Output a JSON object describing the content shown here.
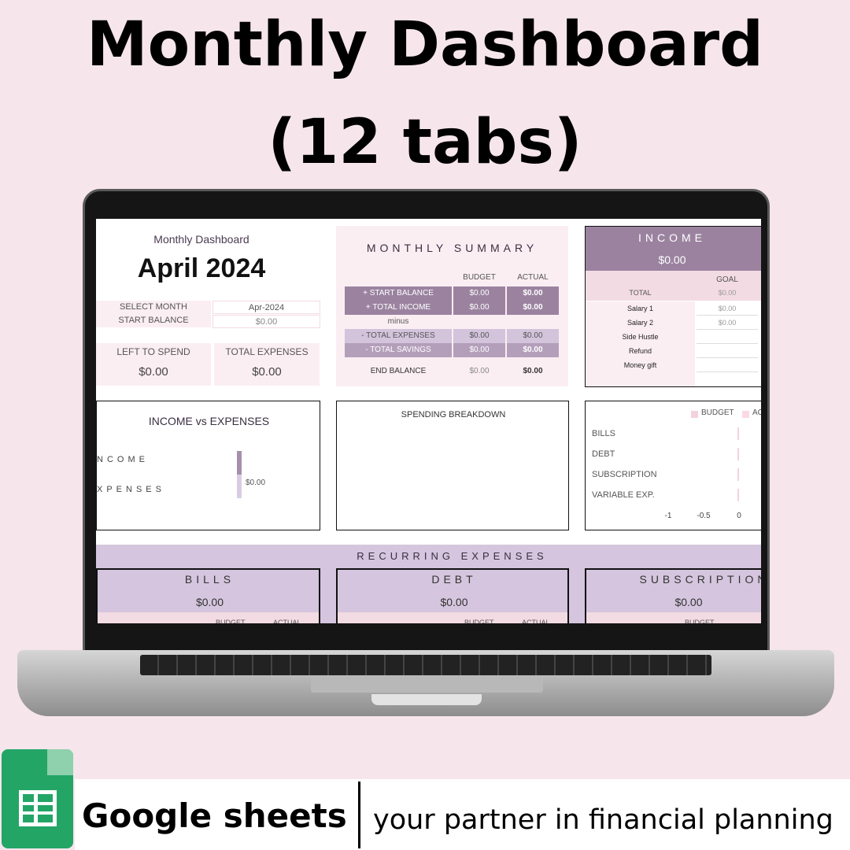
{
  "headline": {
    "line1": "Monthly Dashboard",
    "line2": "(12 tabs)"
  },
  "sheet": {
    "subtitle": "Monthly Dashboard",
    "title": "April 2024",
    "select_month_label": "SELECT MONTH",
    "select_month_value": "Apr-2024",
    "start_balance_label": "START BALANCE",
    "start_balance_value": "$0.00",
    "left_to_spend_label": "LEFT TO SPEND",
    "left_to_spend_value": "$0.00",
    "total_expenses_label": "TOTAL EXPENSES",
    "total_expenses_value": "$0.00",
    "summary": {
      "title": "MONTHLY  SUMMARY",
      "col_budget": "BUDGET",
      "col_actual": "ACTUAL",
      "rows": [
        {
          "label": "+ START BALANCE",
          "budget": "$0.00",
          "actual": "$0.00"
        },
        {
          "label": "+ TOTAL INCOME",
          "budget": "$0.00",
          "actual": "$0.00"
        },
        {
          "label": "- TOTAL EXPENSES",
          "budget": "$0.00",
          "actual": "$0.00"
        },
        {
          "label": "- TOTAL SAVINGS",
          "budget": "$0.00",
          "actual": "$0.00"
        }
      ],
      "minus": "minus",
      "end": {
        "label": "END BALANCE",
        "budget": "$0.00",
        "actual": "$0.00"
      }
    },
    "income": {
      "title": "INCOME",
      "value": "$0.00",
      "goal": "GOAL",
      "total_label": "TOTAL",
      "total_value": "$0.00",
      "rows": [
        {
          "label": "Salary 1",
          "value": "$0.00"
        },
        {
          "label": "Salary 2",
          "value": "$0.00"
        },
        {
          "label": "Side Hustle",
          "value": ""
        },
        {
          "label": "Refund",
          "value": ""
        },
        {
          "label": "Money gift",
          "value": ""
        }
      ]
    },
    "income_vs_expenses": {
      "title": "INCOME vs EXPENSES",
      "income_label": "NCOME",
      "expenses_label": "XPENSES",
      "value_label": "$0.00"
    },
    "spending_breakdown": {
      "title": "SPENDING BREAKDOWN"
    },
    "recurring": {
      "title": "RECURRING EXPENSES",
      "col_budget": "BUDGET",
      "col_actual": "ACTUAL",
      "cards": [
        {
          "title": "BILLS",
          "value": "$0.00"
        },
        {
          "title": "DEBT",
          "value": "$0.00"
        },
        {
          "title": "SUBSCRIPTION",
          "value": "$0.00"
        }
      ]
    }
  },
  "chart_data": {
    "type": "bar",
    "orientation": "horizontal",
    "categories": [
      "BILLS",
      "DEBT",
      "SUBSCRIPTION",
      "VARIABLE EXP."
    ],
    "series": [
      {
        "name": "BUDGET",
        "values": [
          0,
          0,
          0,
          0
        ]
      },
      {
        "name": "AC",
        "values": [
          0,
          0,
          0,
          0
        ]
      }
    ],
    "ticks": [
      "-1",
      "-0.5",
      "0"
    ],
    "xlim": [
      -1,
      0
    ],
    "legend": "top-right",
    "colors": {
      "budget": "#f2d3dd",
      "actual": "#fbd9e3"
    }
  },
  "footer": {
    "brand": "Google sheets",
    "tagline": "your partner in financial planning"
  },
  "colors": {
    "background": "#f6e6ec",
    "purple_dark": "#9b83a0",
    "purple_mid": "#b49fbb",
    "lavender": "#d5c5de",
    "pink": "#f3dbe4",
    "sheets_green": "#23a566"
  }
}
